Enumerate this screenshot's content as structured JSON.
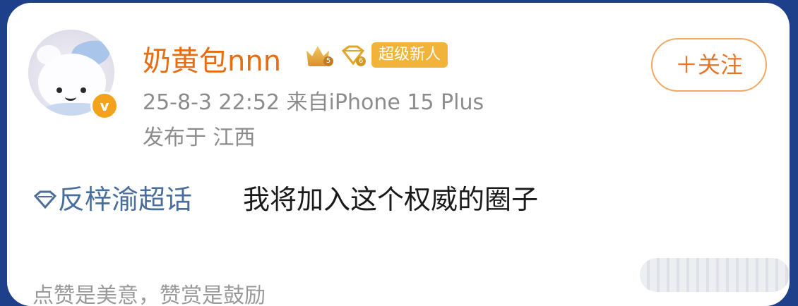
{
  "user": {
    "name": "奶黄包nnn",
    "super_tag": "超级新人",
    "crown_level": "5",
    "gem_level": "6"
  },
  "follow_button": "＋关注",
  "post_meta": {
    "time_device": "25-8-3 22:52  来自iPhone 15 Plus",
    "location": "发布于 江西"
  },
  "post": {
    "topic": "反梓渝超话",
    "text": "我将加入这个权威的圈子"
  },
  "footer": {
    "reward_text": "点赞是美意，赞赏是鼓励"
  },
  "colors": {
    "username": "#e66d12",
    "topic": "#4a6e9c",
    "super_tag": "#f1b33a",
    "follow_border": "#f3a862"
  },
  "icons": [
    "avatar",
    "verified-badge-icon",
    "crown-badge-icon",
    "gem-badge-icon",
    "topic-gem-icon"
  ]
}
